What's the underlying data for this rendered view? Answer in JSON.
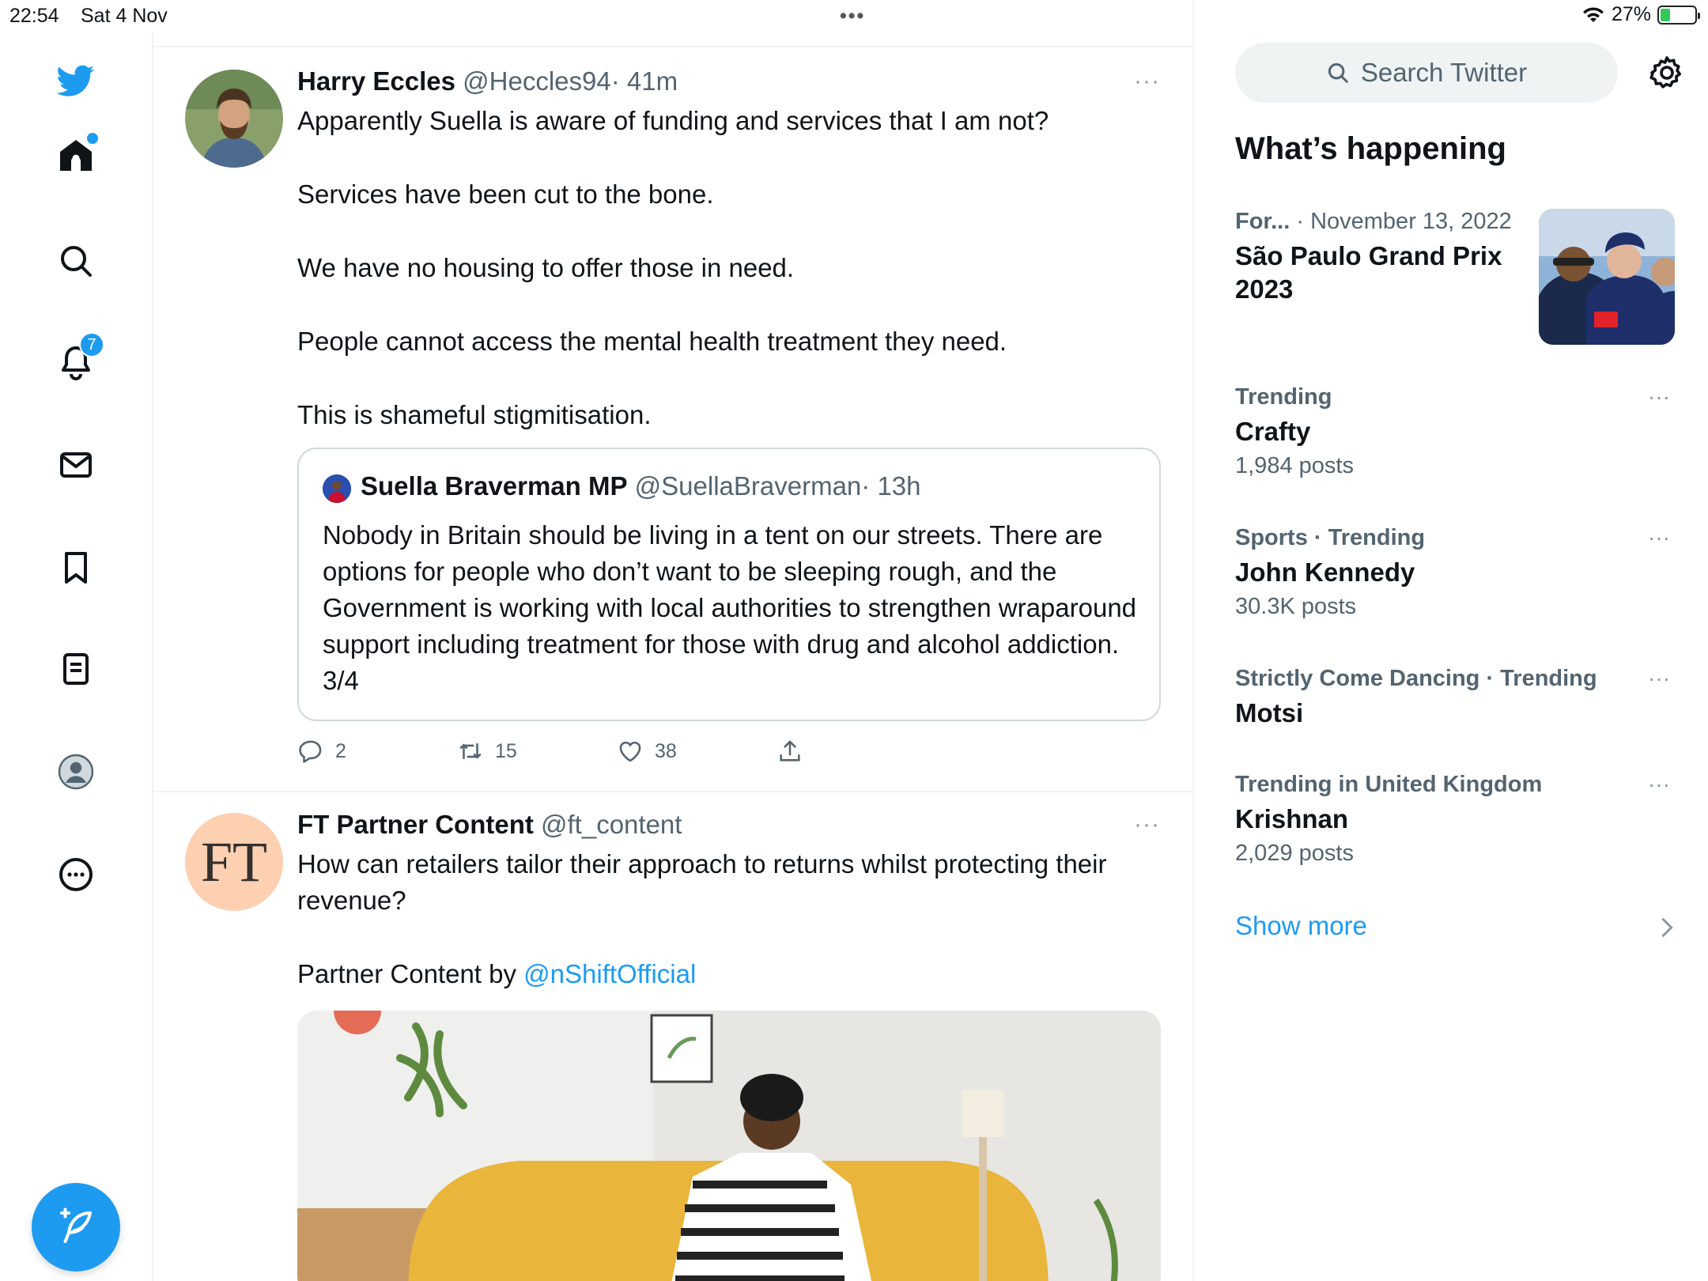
{
  "status_bar": {
    "time": "22:54",
    "date": "Sat 4 Nov",
    "battery": "27%",
    "battery_level": 0.27
  },
  "nav": {
    "notification_count": "7"
  },
  "tweets": [
    {
      "name": "Harry Eccles",
      "handle": "@Heccles94",
      "time": "· 41m",
      "more": "···",
      "paragraphs": [
        "Apparently Suella is aware of funding and services that I am not?",
        "Services have been cut to the bone.",
        "We have no housing to offer those in need.",
        "People cannot access the mental health treatment they need.",
        "This is shameful stigmitisation."
      ],
      "quote": {
        "name": "Suella Braverman MP",
        "handle": "@SuellaBraverman",
        "time": "· 13h",
        "text": "Nobody in Britain should be living in a tent on our streets. There are options for people who don’t want to be sleeping rough, and the Government is working with local authorities to strengthen wraparound support including treatment for those with drug and alcohol addiction. 3/4"
      },
      "replies": "2",
      "retweets": "15",
      "likes": "38"
    },
    {
      "name": "FT Partner Content",
      "handle": "@ft_content",
      "avatar_text": "FT",
      "more": "···",
      "text": "How can retailers tailor their approach to returns whilst protecting their revenue?",
      "partner_prefix": "Partner Content by ",
      "partner_link": "@nShiftOfficial"
    }
  ],
  "right": {
    "search_placeholder": "Search Twitter",
    "whats_happening": "What’s happening",
    "event": {
      "category": "For...",
      "date": "· November 13, 2022",
      "title": "São Paulo Grand Prix 2023"
    },
    "trends": [
      {
        "meta": "Trending",
        "name": "Crafty",
        "count": "1,984 posts"
      },
      {
        "meta": "Sports · Trending",
        "name": "John Kennedy",
        "count": "30.3K posts"
      },
      {
        "meta": "Strictly Come Dancing · Trending",
        "name": "Motsi",
        "count": ""
      },
      {
        "meta": "Trending in United Kingdom",
        "name": "Krishnan",
        "count": "2,029 posts"
      }
    ],
    "trend_more": "···",
    "show_more": "Show more"
  },
  "colors": {
    "accent": "#1d9bf0",
    "text": "#0f1419",
    "secondary": "#536471",
    "border": "#eff3f4"
  }
}
